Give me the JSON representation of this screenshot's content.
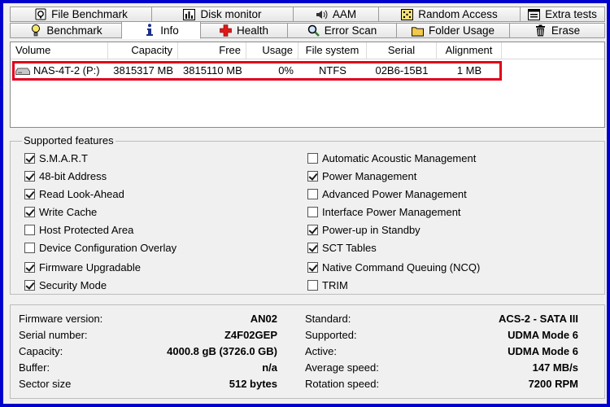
{
  "tabs_row1": [
    {
      "label": "File Benchmark",
      "icon": "stopwatch-icon"
    },
    {
      "label": "Disk monitor",
      "icon": "bar-chart-icon"
    },
    {
      "label": "AAM",
      "icon": "speaker-icon"
    },
    {
      "label": "Random Access",
      "icon": "dice-icon"
    },
    {
      "label": "Extra tests",
      "icon": "window-icon"
    }
  ],
  "tabs_row2": [
    {
      "label": "Benchmark",
      "icon": "lightbulb-icon"
    },
    {
      "label": "Info",
      "icon": "info-icon",
      "active": true
    },
    {
      "label": "Health",
      "icon": "red-cross-icon"
    },
    {
      "label": "Error Scan",
      "icon": "magnifier-icon"
    },
    {
      "label": "Folder Usage",
      "icon": "folder-icon"
    },
    {
      "label": "Erase",
      "icon": "trash-icon"
    }
  ],
  "volumes": {
    "headers": [
      "Volume",
      "Capacity",
      "Free",
      "Usage",
      "File system",
      "Serial",
      "Alignment"
    ],
    "rows": [
      {
        "volume": "NAS-4T-2 (P:)",
        "capacity": "3815317 MB",
        "free": "3815110 MB",
        "usage": "0%",
        "fs": "NTFS",
        "serial": "02B6-15B1",
        "alignment": "1 MB"
      }
    ]
  },
  "features": {
    "title": "Supported features",
    "left": [
      {
        "label": "S.M.A.R.T",
        "checked": true
      },
      {
        "label": "48-bit Address",
        "checked": true
      },
      {
        "label": "Read Look-Ahead",
        "checked": true
      },
      {
        "label": "Write Cache",
        "checked": true
      },
      {
        "label": "Host Protected Area",
        "checked": false
      },
      {
        "label": "Device Configuration Overlay",
        "checked": false
      },
      {
        "label": "Firmware Upgradable",
        "checked": true
      },
      {
        "label": "Security Mode",
        "checked": true
      }
    ],
    "right": [
      {
        "label": "Automatic Acoustic Management",
        "checked": false
      },
      {
        "label": "Power Management",
        "checked": true
      },
      {
        "label": "Advanced Power Management",
        "checked": false
      },
      {
        "label": "Interface Power Management",
        "checked": false
      },
      {
        "label": "Power-up in Standby",
        "checked": true
      },
      {
        "label": "SCT Tables",
        "checked": true
      },
      {
        "label": "Native Command Queuing (NCQ)",
        "checked": true
      },
      {
        "label": "TRIM",
        "checked": false
      }
    ]
  },
  "info": {
    "left": [
      {
        "key": "Firmware version:",
        "value": "AN02"
      },
      {
        "key": "Serial number:",
        "value": "Z4F02GEP"
      },
      {
        "key": "Capacity:",
        "value": "4000.8 gB (3726.0 GB)"
      },
      {
        "key": "Buffer:",
        "value": "n/a"
      },
      {
        "key": "Sector size",
        "value": "512 bytes"
      }
    ],
    "right": [
      {
        "key": "Standard:",
        "value": "ACS-2 - SATA III"
      },
      {
        "key": "Supported:",
        "value": "UDMA Mode 6"
      },
      {
        "key": "Active:",
        "value": "UDMA Mode 6"
      },
      {
        "key": "Average speed:",
        "value": "147 MB/s"
      },
      {
        "key": "Rotation speed:",
        "value": "7200 RPM"
      }
    ]
  },
  "colors": {
    "frame": "#0000cc",
    "highlight": "#e0001a",
    "background": "#f0f0f0"
  }
}
